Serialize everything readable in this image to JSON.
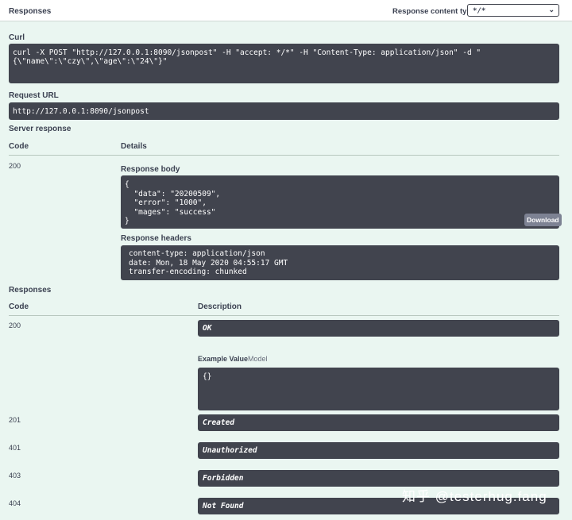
{
  "header": {
    "title": "Responses",
    "content_type_label": "Response content type",
    "content_type_value": "*/*"
  },
  "curl": {
    "label": "Curl",
    "line1": "curl -X POST \"http://127.0.0.1:8090/jsonpost\" -H \"accept: */*\" -H \"Content-Type: application/json\" -d \"",
    "line2": "{\\\"name\\\":\\\"czy\\\",\\\"age\\\":\\\"24\\\"}\""
  },
  "request_url": {
    "label": "Request URL",
    "value": "http://127.0.0.1:8090/jsonpost"
  },
  "server_response": {
    "label": "Server response",
    "col_code": "Code",
    "col_details": "Details",
    "code": "200",
    "body_label": "Response body",
    "body_lines": [
      "{",
      "  \"data\": \"20200509\",",
      "  \"error\": \"1000\",",
      "  \"mages\": \"success\"",
      "}"
    ],
    "download_label": "Download",
    "headers_label": "Response headers",
    "headers_lines": [
      "content-type: application/json",
      "date: Mon, 18 May 2020 04:55:17 GMT",
      "transfer-encoding: chunked"
    ]
  },
  "responses": {
    "label": "Responses",
    "col_code": "Code",
    "col_description": "Description",
    "example_value_label": "Example Value",
    "model_label": "Model",
    "example_body": "{}",
    "items": [
      {
        "code": "200",
        "description": "OK"
      },
      {
        "code": "201",
        "description": "Created"
      },
      {
        "code": "401",
        "description": "Unauthorized"
      },
      {
        "code": "403",
        "description": "Forbidden"
      },
      {
        "code": "404",
        "description": "Not Found"
      }
    ]
  },
  "watermark": "知乎 @testerhug.fang"
}
